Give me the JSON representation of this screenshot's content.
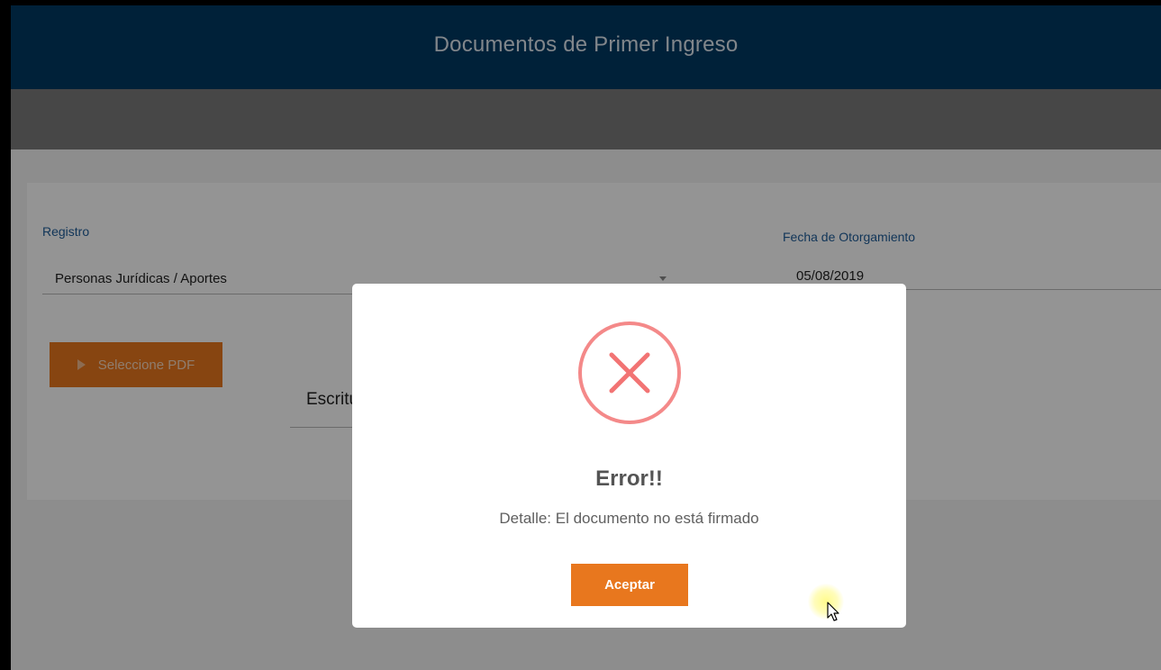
{
  "header": {
    "title": "Documentos de Primer Ingreso"
  },
  "form": {
    "registro": {
      "label": "Registro",
      "value": "Personas Jurídicas / Aportes"
    },
    "fecha": {
      "label": "Fecha de Otorgamiento",
      "value": "05/08/2019"
    },
    "pdf_button_label": "Seleccione PDF",
    "document_type": "Escritur"
  },
  "modal": {
    "icon": "error-x-icon",
    "title": "Error!!",
    "detail": "Detalle: El documento no está firmado",
    "ok_label": "Aceptar"
  },
  "colors": {
    "header_bg": "#013a63",
    "accent": "#e8771e",
    "error_icon": "#f27474",
    "label_blue": "#1f5d99"
  }
}
